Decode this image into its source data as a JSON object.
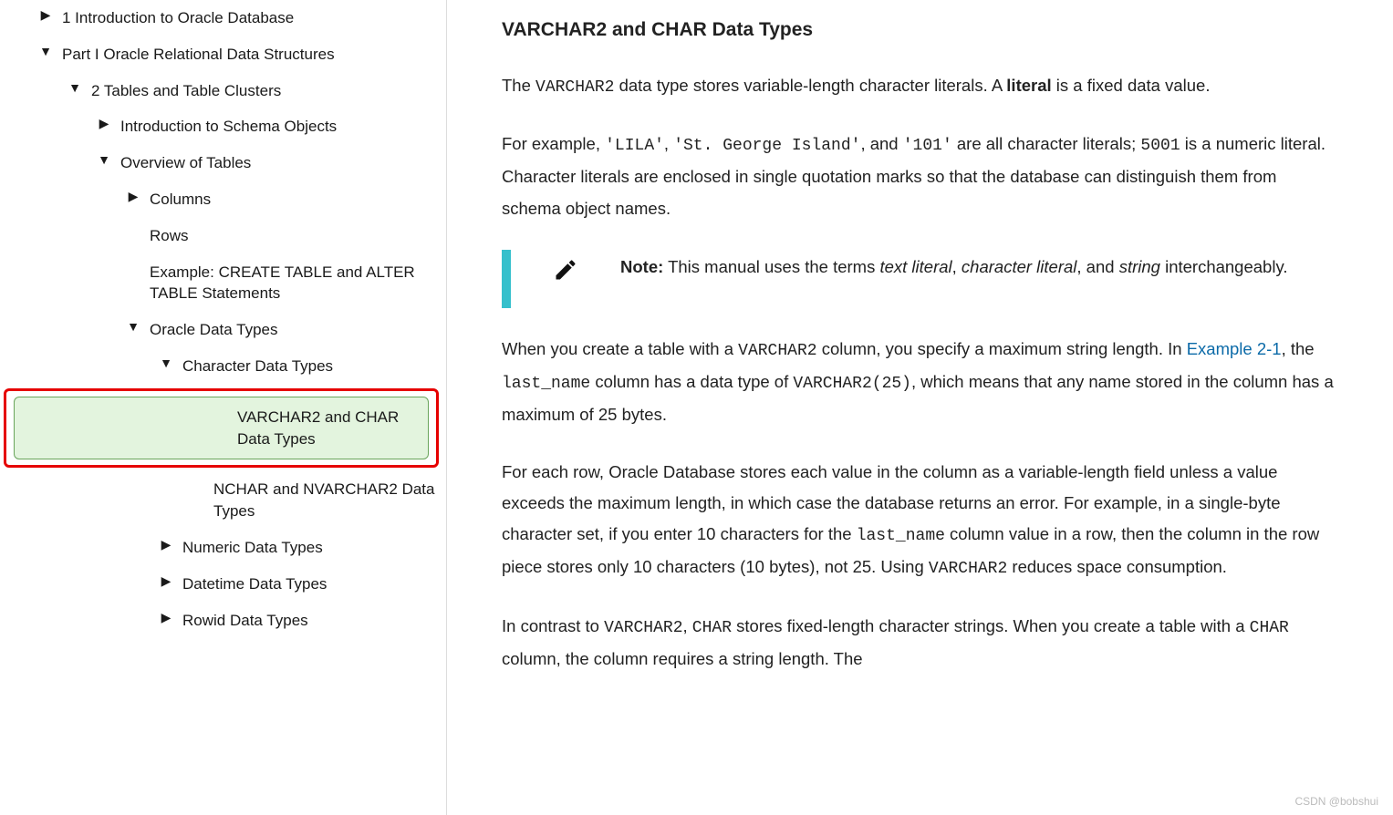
{
  "sidebar": {
    "items": [
      {
        "label": "1 Introduction to Oracle Database",
        "depth": 0,
        "arrow": "right"
      },
      {
        "label": "Part I Oracle Relational Data Structures",
        "depth": 0,
        "arrow": "down"
      },
      {
        "label": "2 Tables and Table Clusters",
        "depth": 1,
        "arrow": "down"
      },
      {
        "label": "Introduction to Schema Objects",
        "depth": 2,
        "arrow": "right"
      },
      {
        "label": "Overview of Tables",
        "depth": 2,
        "arrow": "down"
      },
      {
        "label": "Columns",
        "depth": 3,
        "arrow": "right"
      },
      {
        "label": "Rows",
        "depth": 3,
        "arrow": "none"
      },
      {
        "label": "Example: CREATE TABLE and ALTER TABLE Statements",
        "depth": 3,
        "arrow": "none"
      },
      {
        "label": "Oracle Data Types",
        "depth": 3,
        "arrow": "down"
      },
      {
        "label": "Character Data Types",
        "depth": 4,
        "arrow": "down"
      },
      {
        "label": "VARCHAR2 and CHAR Data Types",
        "depth": 5,
        "arrow": "selected"
      },
      {
        "label": "NCHAR and NVARCHAR2 Data Types",
        "depth": 5,
        "arrow": "none"
      },
      {
        "label": "Numeric Data Types",
        "depth": 4,
        "arrow": "right"
      },
      {
        "label": "Datetime Data Types",
        "depth": 4,
        "arrow": "right"
      },
      {
        "label": "Rowid Data Types",
        "depth": 4,
        "arrow": "right"
      }
    ]
  },
  "content": {
    "heading": "VARCHAR2 and CHAR Data Types",
    "p1_a": "The ",
    "p1_code1": "VARCHAR2",
    "p1_b": " data type stores variable-length character literals. A ",
    "p1_strong": "literal",
    "p1_c": " is a fixed data value.",
    "p2_a": "For example, ",
    "p2_code1": "'LILA'",
    "p2_b": ", ",
    "p2_code2": "'St. George Island'",
    "p2_c": ", and ",
    "p2_code3": "'101'",
    "p2_d": " are all character literals; ",
    "p2_code4": "5001",
    "p2_e": " is a numeric literal. Character literals are enclosed in single quotation marks so that the database can distinguish them from schema object names.",
    "note_label": "Note:",
    "note_a": " This manual uses the terms ",
    "note_em1": "text literal",
    "note_b": ", ",
    "note_em2": "character literal",
    "note_c": ", and ",
    "note_em3": "string",
    "note_d": " interchangeably.",
    "p3_a": "When you create a table with a ",
    "p3_code1": "VARCHAR2",
    "p3_b": " column, you specify a maximum string length. In ",
    "p3_link": "Example 2-1",
    "p3_c": ", the ",
    "p3_code2": "last_name",
    "p3_d": " column has a data type of ",
    "p3_code3": "VARCHAR2(25)",
    "p3_e": ", which means that any name stored in the column has a maximum of 25 bytes.",
    "p4_a": "For each row, Oracle Database stores each value in the column as a variable-length field unless a value exceeds the maximum length, in which case the database returns an error. For example, in a single-byte character set, if you enter 10 characters for the ",
    "p4_code1": "last_name",
    "p4_b": " column value in a row, then the column in the row piece stores only 10 characters (10 bytes), not 25. Using ",
    "p4_code2": "VARCHAR2",
    "p4_c": " reduces space consumption.",
    "p5_a": "In contrast to ",
    "p5_code1": "VARCHAR2",
    "p5_b": ", ",
    "p5_code2": "CHAR",
    "p5_c": " stores fixed-length character strings. When you create a table with a ",
    "p5_code3": "CHAR",
    "p5_d": " column, the column requires a string length. The"
  },
  "watermark": "CSDN @bobshui"
}
